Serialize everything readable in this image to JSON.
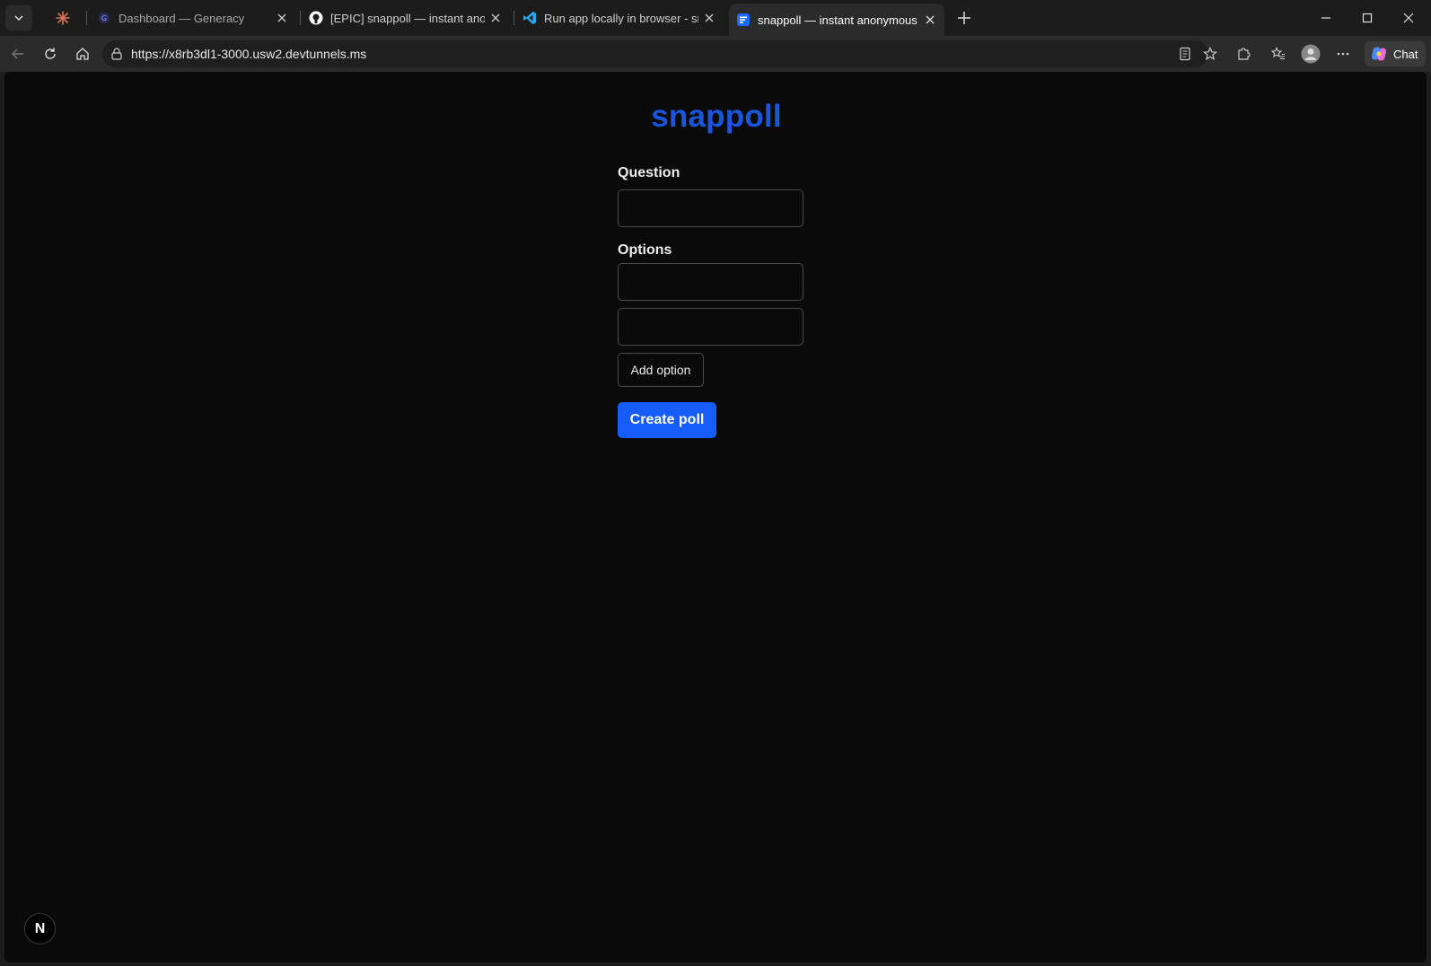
{
  "browser": {
    "tabs": [
      {
        "title": "",
        "icon": "claude-sparkle-icon"
      },
      {
        "title": "Dashboard — Generacy",
        "icon": "generacy-icon"
      },
      {
        "title": "[EPIC] snappoll — instant anonymous polls",
        "icon": "github-icon"
      },
      {
        "title": "Run app locally in browser - snappoll",
        "icon": "vscode-icon"
      },
      {
        "title": "snappoll — instant anonymous polls",
        "icon": "page-icon",
        "active": true
      }
    ],
    "url": "https://x8rb3dl1-3000.usw2.devtunnels.ms",
    "chat_label": "Chat"
  },
  "app": {
    "title": "snappoll",
    "question_label": "Question",
    "question_value": "",
    "options_label": "Options",
    "options": [
      "",
      ""
    ],
    "add_option_label": "Add option",
    "create_poll_label": "Create poll",
    "dev_badge": "N",
    "brand_color": "#155cfb"
  }
}
